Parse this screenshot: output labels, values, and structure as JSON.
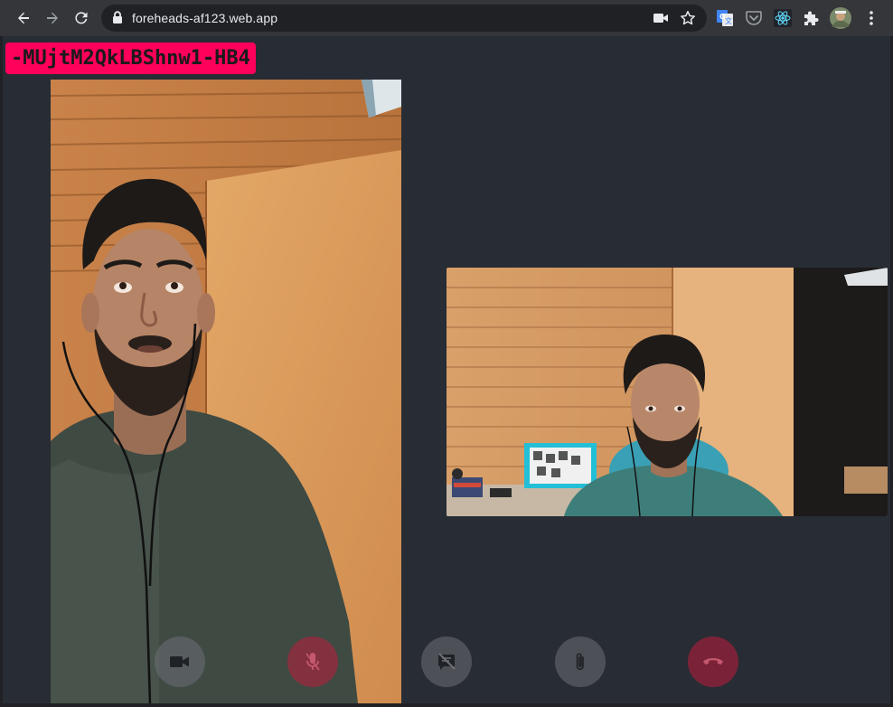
{
  "browser": {
    "url": "foreheads-af123.web.app",
    "icons": {
      "back": "back-arrow-icon",
      "forward": "forward-arrow-icon",
      "reload": "reload-icon",
      "lock": "lock-icon",
      "camera_indicator": "camera-icon",
      "bookmark": "star-icon",
      "extensions": [
        "translate-icon",
        "pocket-icon",
        "react-devtools-icon",
        "puzzle-piece-icon"
      ],
      "profile": "avatar",
      "menu": "kebab-menu-icon"
    }
  },
  "room": {
    "id": "-MUjtM2QkLBShnw1-HB4",
    "badge_color": "#ff005a"
  },
  "videos": {
    "remote": "remote-video",
    "local": "local-video"
  },
  "controls": [
    {
      "name": "toggle-camera-button",
      "icon": "video-camera-icon",
      "state": "on"
    },
    {
      "name": "toggle-mic-button",
      "icon": "microphone-off-icon",
      "state": "muted"
    },
    {
      "name": "toggle-chat-button",
      "icon": "chat-off-icon",
      "state": "off"
    },
    {
      "name": "attach-file-button",
      "icon": "paperclip-icon",
      "state": "idle"
    },
    {
      "name": "hang-up-button",
      "icon": "phone-hangup-icon",
      "state": "active"
    }
  ],
  "colors": {
    "app_background": "#282c34",
    "toolbar": "#35363a",
    "control_gray": "#6e7076",
    "control_red": "#be1e3c"
  }
}
